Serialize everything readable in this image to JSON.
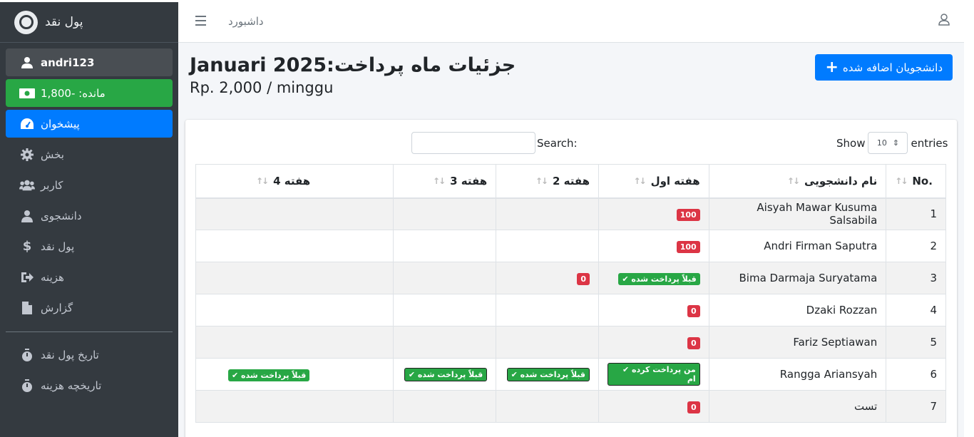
{
  "brand": {
    "name": "پول نقد"
  },
  "sidebar": {
    "user": "andri123",
    "balance": "مانده: -1,800",
    "items": [
      {
        "label": "پیشخوان",
        "icon": "dashboard-icon"
      },
      {
        "label": "بخش",
        "icon": "gear-icon"
      },
      {
        "label": "کاربر",
        "icon": "users-icon"
      },
      {
        "label": "دانشجوی",
        "icon": "user-graduate-icon"
      },
      {
        "label": "پول نقد",
        "icon": "dollar-icon"
      },
      {
        "label": "هزینه",
        "icon": "sign-out-icon"
      },
      {
        "label": "گزارش",
        "icon": "file-icon"
      }
    ],
    "history": [
      {
        "label": "تاریخ پول نقد",
        "icon": "stopwatch-icon"
      },
      {
        "label": "تاریخچه هزینه",
        "icon": "stopwatch-icon"
      }
    ]
  },
  "topbar": {
    "title": "داشبورد"
  },
  "header": {
    "title": "Januari 2025:جزئیات ماه پرداخت",
    "subtitle": "Rp. 2,000 / minggu",
    "add_button": "دانشجویان اضافه شده"
  },
  "table_controls": {
    "show": "Show",
    "entries_value": "10",
    "entries": "entries",
    "search_label": "Search:"
  },
  "table": {
    "headers": {
      "no": "No.",
      "name": "نام دانشجویی",
      "week1": "هفته اول",
      "week2": "هفته 2",
      "week3": "هفته 3",
      "week4": "هفته 4"
    },
    "rows": [
      {
        "no": "1",
        "name": "Aisyah Mawar Kusuma Salsabila",
        "weeks": [
          {
            "text": "100",
            "type": "red"
          },
          null,
          null,
          null
        ]
      },
      {
        "no": "2",
        "name": "Andri Firman Saputra",
        "weeks": [
          {
            "text": "100",
            "type": "red"
          },
          null,
          null,
          null
        ]
      },
      {
        "no": "3",
        "name": "Bima Darmaja Suryatama",
        "weeks": [
          {
            "text": "✔ قبلاً پرداخت شده",
            "type": "green"
          },
          {
            "text": "0",
            "type": "red"
          },
          null,
          null
        ]
      },
      {
        "no": "4",
        "name": "Dzaki Rozzan",
        "weeks": [
          {
            "text": "0",
            "type": "red"
          },
          null,
          null,
          null
        ]
      },
      {
        "no": "5",
        "name": "Fariz Septiawan",
        "weeks": [
          {
            "text": "0",
            "type": "red"
          },
          null,
          null,
          null
        ]
      },
      {
        "no": "6",
        "name": "Rangga Ariansyah",
        "weeks": [
          {
            "text": "✔ من پرداخت کرده ام",
            "type": "green outl"
          },
          {
            "text": "✔ قبلاً پرداخت شده",
            "type": "green outl"
          },
          {
            "text": "✔ قبلاً پرداخت شده",
            "type": "green outl"
          },
          {
            "text": "✔ قبلاً پرداخت شده",
            "type": "green"
          }
        ]
      },
      {
        "no": "7",
        "name": "تست",
        "weeks": [
          {
            "text": "0",
            "type": "red"
          },
          null,
          null,
          null
        ]
      }
    ]
  },
  "colors": {
    "sidebar": "#343a40",
    "primary": "#007bff",
    "success": "#28a745",
    "danger": "#dc3545"
  }
}
